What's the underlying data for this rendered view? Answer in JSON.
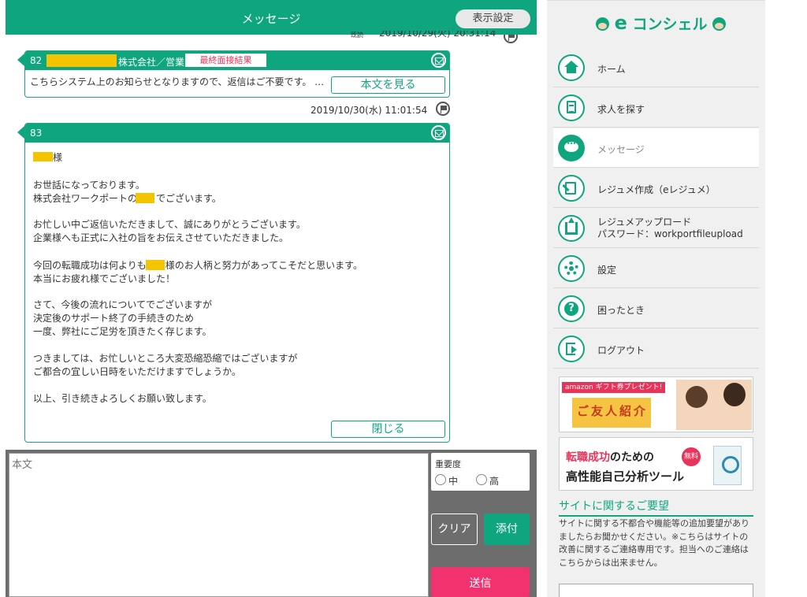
{
  "header": {
    "title": "メッセージ",
    "display_settings": "表示設定"
  },
  "messages": [
    {
      "partial_stamp_label": "既読",
      "partial_stamp": "2019/10/29(火) 20:31:14"
    },
    {
      "number": "82",
      "company_suffix": "株式会社／営業",
      "badge": "最終面接結果",
      "preview": "こちらシステム上のお知らせとなりますので、返信はご不要です。 …",
      "view_button": "本文を見る",
      "timestamp": "2019/10/30(水) 11:01:54"
    },
    {
      "number": "83",
      "salutation_suffix": "様",
      "lines": [
        "お世話になっております。",
        "株式会社ワークポートの　　でございます。",
        "お忙しい中ご返信いただきまして、誠にありがとうございます。",
        "企業様へも正式に入社の旨をお伝えさせていただきました。",
        "今回の転職成功は何よりも　　様のお人柄と努力があってこそだと思います。",
        "本当にお疲れ様でございました！",
        "さて、今後の流れについてでございますが",
        "決定後のサポート終了の手続きのため",
        "一度、弊社にご足労を頂きたく存じます。",
        "つきましては、お忙しいところ大変恐縮恐縮ではございますが",
        "ご都合の宜しい日時をいただけますでしょうか。",
        "以上、引き続きよろしくお願い致します。"
      ],
      "close_button": "閉じる"
    }
  ],
  "compose": {
    "placeholder": "本文",
    "priority_label": "重要度",
    "priority_options": [
      "中",
      "高"
    ],
    "clear": "クリア",
    "attach": "添付",
    "send": "送信"
  },
  "sidebar": {
    "logo_prefix": "e",
    "logo_text": "コンシェル",
    "nav": [
      {
        "label": "ホーム",
        "icon": "home-icon"
      },
      {
        "label": "求人を探す",
        "icon": "document-icon"
      },
      {
        "label": "メッセージ",
        "icon": "chat-bubble-icon",
        "active": true
      },
      {
        "label": "レジュメ作成（eレジュメ）",
        "icon": "resume-edit-icon"
      },
      {
        "label": "レジュメアップロード",
        "label2": "パスワード：workportfileupload",
        "icon": "upload-icon"
      },
      {
        "label": "設定",
        "icon": "gear-icon"
      },
      {
        "label": "困ったとき",
        "icon": "help-icon"
      },
      {
        "label": "ログアウト",
        "icon": "logout-icon"
      }
    ],
    "banner1": {
      "tag": "amazon ギフト券プレゼント!",
      "text": "ご友人紹介"
    },
    "banner2": {
      "line1_highlight": "転職成功",
      "line1_rest": "のための",
      "free": "無料",
      "line2": "高性能自己分析ツール"
    },
    "site_request": {
      "title": "サイトに関するご要望",
      "description": "サイトに関する不都合や機能等の追加要望がありましたらお聞かせください。※こちらはサイトの改善に関するご連絡専用です。担当へのご連絡はこちらからは出来ません。"
    }
  },
  "colors": {
    "primary_green": "#0fa67f",
    "send_pink": "#f2316f",
    "badge_red": "#e8335a",
    "mask_yellow": "#f5c400"
  }
}
